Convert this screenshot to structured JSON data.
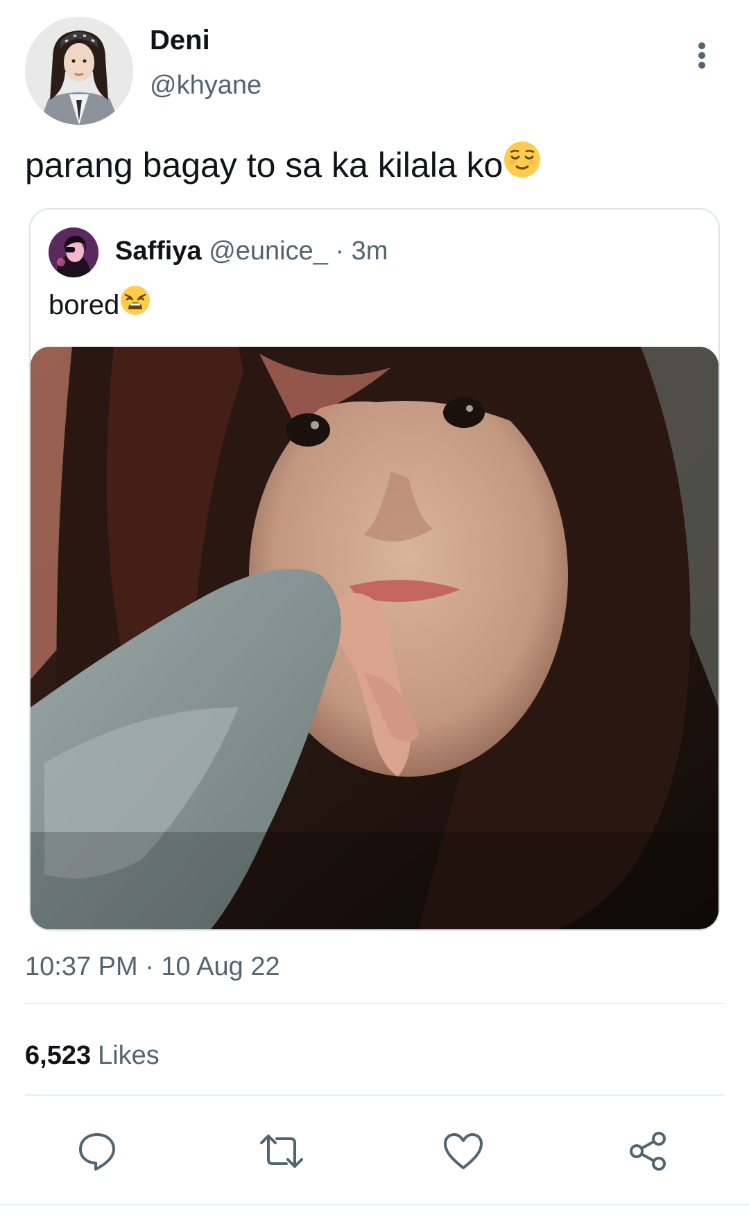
{
  "author": {
    "display_name": "Deni",
    "handle": "@khyane"
  },
  "tweet": {
    "text": "parang bagay to sa ka kilala ko",
    "emoji": "relieved-face-emoji"
  },
  "quoted_tweet": {
    "display_name": "Saffiya",
    "handle": "@eunice_",
    "separator": "·",
    "time_ago": "3m",
    "text": "bored",
    "emoji": "weary-face-emoji",
    "media": "selfie-photo"
  },
  "meta": {
    "timestamp": "10:37 PM · 10 Aug 22"
  },
  "stats": {
    "likes_count": "6,523",
    "likes_label": "Likes"
  },
  "actions": {
    "reply_icon": "reply-icon",
    "retweet_icon": "retweet-icon",
    "like_icon": "heart-icon",
    "share_icon": "share-icon"
  },
  "colors": {
    "primary_text": "#0f1419",
    "secondary_text": "#536471",
    "border": "#dde3e8",
    "icon": "#536471"
  }
}
